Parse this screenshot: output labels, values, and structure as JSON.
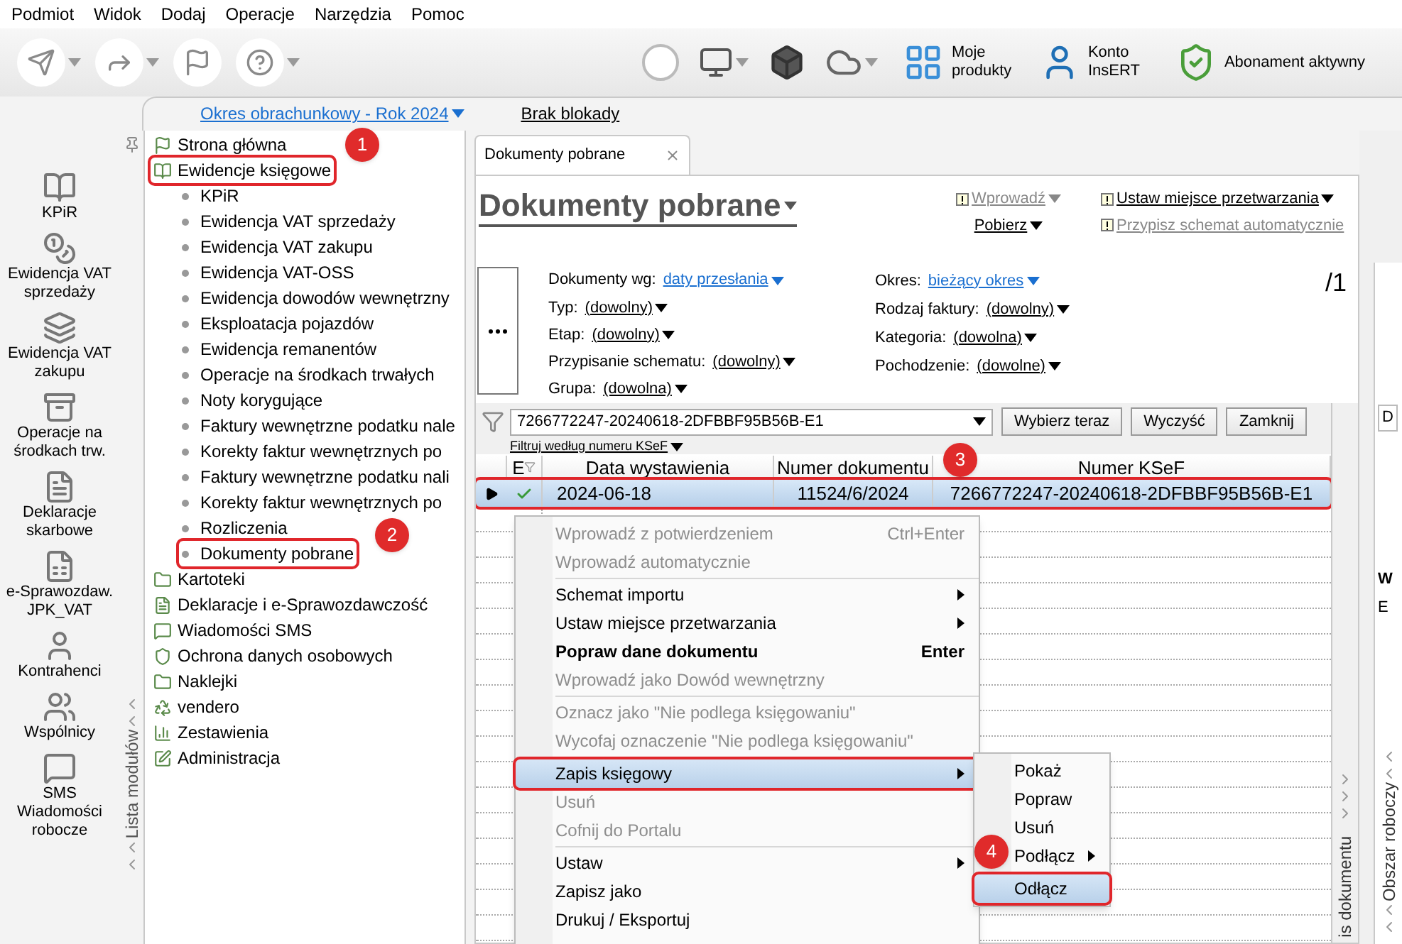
{
  "menu_bar": [
    "Podmiot",
    "Widok",
    "Dodaj",
    "Operacje",
    "Narzędzia",
    "Pomoc"
  ],
  "toolbar": {
    "labeled_buttons": [
      {
        "label": "Moje produkty",
        "kind": "products"
      },
      {
        "label": "Konto InsERT",
        "kind": "account"
      },
      {
        "label": "Abonament aktywny",
        "kind": "subscription"
      }
    ]
  },
  "period_bar": {
    "period": "Okres obrachunkowy - Rok 2024",
    "lock": "Brak blokady"
  },
  "shortcuts": [
    {
      "label": "KPiR",
      "kind": "book"
    },
    {
      "label": "Ewidencja VAT sprzedaży",
      "kind": "coins"
    },
    {
      "label": "Ewidencja VAT zakupu",
      "kind": "binders"
    },
    {
      "label": "Operacje na środkach trw.",
      "kind": "cabinet"
    },
    {
      "label": "Deklaracje skarbowe",
      "kind": "forms"
    },
    {
      "label": "e-Sprawozdaw. JPK_VAT",
      "kind": "jpk"
    },
    {
      "label": "Kontrahenci",
      "kind": "person"
    },
    {
      "label": "Wspólnicy",
      "kind": "people"
    },
    {
      "label": "SMS Wiadomości robocze",
      "kind": "sms"
    }
  ],
  "module_list": {
    "title": "Lista modułów",
    "items": [
      {
        "label": "Strona główna",
        "kind": "flag",
        "outlined": false
      },
      {
        "label": "Ewidencje księgowe",
        "kind": "book",
        "outlined": true,
        "children": [
          {
            "label": "KPiR",
            "outlined": false
          },
          {
            "label": "Ewidencja VAT sprzedaży",
            "outlined": false
          },
          {
            "label": "Ewidencja VAT zakupu",
            "outlined": false
          },
          {
            "label": "Ewidencja VAT-OSS",
            "outlined": false
          },
          {
            "label": "Ewidencja dowodów wewnętrzny",
            "outlined": false
          },
          {
            "label": "Eksploatacja pojazdów",
            "outlined": false
          },
          {
            "label": "Ewidencja remanentów",
            "outlined": false
          },
          {
            "label": "Operacje na środkach trwałych",
            "outlined": false
          },
          {
            "label": "Noty korygujące",
            "outlined": false
          },
          {
            "label": "Faktury wewnętrzne podatku nale",
            "outlined": false
          },
          {
            "label": "Korekty faktur wewnętrznych po",
            "outlined": false
          },
          {
            "label": "Faktury wewnętrzne podatku nali",
            "outlined": false
          },
          {
            "label": "Korekty faktur wewnętrznych po",
            "outlined": false
          },
          {
            "label": "Rozliczenia",
            "outlined": false
          },
          {
            "label": "Dokumenty pobrane",
            "outlined": true
          }
        ]
      },
      {
        "label": "Kartoteki",
        "kind": "folders",
        "outlined": false
      },
      {
        "label": "Deklaracje i e-Sprawozdawczość",
        "kind": "forms",
        "outlined": false
      },
      {
        "label": "Wiadomości SMS",
        "kind": "sms",
        "outlined": false
      },
      {
        "label": "Ochrona danych osobowych",
        "kind": "shield",
        "outlined": false
      },
      {
        "label": "Naklejki",
        "kind": "folders",
        "outlined": false
      },
      {
        "label": "vendero",
        "kind": "recycle",
        "outlined": false
      },
      {
        "label": "Zestawienia",
        "kind": "chart",
        "outlined": false
      },
      {
        "label": "Administracja",
        "kind": "edit",
        "outlined": false
      }
    ]
  },
  "document_tabs": [
    {
      "label": "Dokumenty pobrane",
      "selected": true
    }
  ],
  "page_title": "Dokumenty pobrane",
  "actions": [
    {
      "label": "Wprowadź",
      "disabled": true,
      "flag": true,
      "dropdown": true
    },
    {
      "label": "Ustaw miejsce przetwarzania",
      "disabled": false,
      "flag": true,
      "dropdown": true
    },
    {
      "label": "Pobierz",
      "disabled": false,
      "flag": false,
      "dropdown": true
    },
    {
      "label": "Przypisz schemat automatycznie",
      "disabled": true,
      "flag": true,
      "dropdown": false
    }
  ],
  "counter": "/1",
  "filters_left": [
    {
      "label": "Dokumenty wg:",
      "value": "daty przesłania",
      "kind": "link"
    },
    {
      "label": "Typ:",
      "value": "(dowolny)",
      "kind": "dropdown"
    },
    {
      "label": "Etap:",
      "value": "(dowolny)",
      "kind": "dropdown"
    },
    {
      "label": "Przypisanie schematu:",
      "value": "(dowolny)",
      "kind": "dropdown"
    },
    {
      "label": "Grupa:",
      "value": "(dowolna)",
      "kind": "dropdown"
    }
  ],
  "filters_right": [
    {
      "label": "Okres:",
      "value": "bieżący okres",
      "kind": "link"
    },
    {
      "label": "Rodzaj faktury:",
      "value": "(dowolny)",
      "kind": "dropdown"
    },
    {
      "label": "Kategoria:",
      "value": "(dowolna)",
      "kind": "dropdown"
    },
    {
      "label": "Pochodzenie:",
      "value": "(dowolne)",
      "kind": "dropdown"
    }
  ],
  "search": {
    "value": "7266772247-20240618-2DFBBF95B56B-E1",
    "buttons": [
      "Wybierz teraz",
      "Wyczyść",
      "Zamknij"
    ],
    "filter_mode": "Filtruj według numeru KSeF"
  },
  "table": {
    "columns": [
      "E",
      "Data wystawienia",
      "Numer dokumentu",
      "Numer KSeF"
    ],
    "rows": [
      {
        "selected": true,
        "checked": true,
        "outlined": true,
        "cells": [
          "",
          "2024-06-18",
          "11524/6/2024",
          "7266772247-20240618-2DFBBF95B56B-E1"
        ]
      }
    ]
  },
  "context_menu": [
    {
      "kind": "command",
      "label": "Wprowadź z potwierdzeniem",
      "shortcut": "Ctrl+Enter",
      "disabled": true,
      "submenu": false,
      "selected": false,
      "outlined": false
    },
    {
      "kind": "command",
      "label": "Wprowadź automatycznie",
      "disabled": true,
      "submenu": false,
      "selected": false,
      "outlined": false
    },
    {
      "kind": "separator"
    },
    {
      "kind": "command",
      "label": "Schemat importu",
      "disabled": false,
      "submenu": true,
      "selected": false,
      "outlined": false
    },
    {
      "kind": "command",
      "label": "Ustaw miejsce przetwarzania",
      "disabled": false,
      "submenu": true,
      "selected": false,
      "outlined": false
    },
    {
      "kind": "default",
      "label": "Popraw dane dokumentu",
      "shortcut": "Enter",
      "disabled": false,
      "submenu": false,
      "selected": false,
      "outlined": false
    },
    {
      "kind": "command",
      "label": "Wprowadź jako Dowód wewnętrzny",
      "disabled": true,
      "submenu": false,
      "selected": false,
      "outlined": false
    },
    {
      "kind": "separator"
    },
    {
      "kind": "command",
      "label": "Oznacz jako \"Nie podlega księgowaniu\"",
      "disabled": true,
      "submenu": false,
      "selected": false,
      "outlined": false
    },
    {
      "kind": "command",
      "label": "Wycofaj oznaczenie \"Nie podlega księgowaniu\"",
      "disabled": true,
      "submenu": false,
      "selected": false,
      "outlined": false
    },
    {
      "kind": "separator"
    },
    {
      "kind": "command",
      "label": "Zapis księgowy",
      "disabled": false,
      "submenu": true,
      "selected": true,
      "outlined": true
    },
    {
      "kind": "command",
      "label": "Usuń",
      "disabled": true,
      "submenu": false,
      "selected": false,
      "outlined": false
    },
    {
      "kind": "command",
      "label": "Cofnij do Portalu",
      "disabled": true,
      "submenu": false,
      "selected": false,
      "outlined": false
    },
    {
      "kind": "separator"
    },
    {
      "kind": "command",
      "label": "Ustaw",
      "disabled": false,
      "submenu": true,
      "selected": false,
      "outlined": false
    },
    {
      "kind": "command",
      "label": "Zapisz jako",
      "disabled": false,
      "submenu": false,
      "selected": false,
      "outlined": false
    },
    {
      "kind": "command",
      "label": "Drukuj / Eksportuj",
      "disabled": false,
      "submenu": false,
      "selected": false,
      "outlined": false
    }
  ],
  "submenu": [
    {
      "kind": "command",
      "label": "Pokaż",
      "submenu": false,
      "selected": false,
      "outlined": false
    },
    {
      "kind": "command",
      "label": "Popraw",
      "submenu": false,
      "selected": false,
      "outlined": false
    },
    {
      "kind": "command",
      "label": "Usuń",
      "submenu": false,
      "selected": false,
      "outlined": false
    },
    {
      "kind": "command",
      "label": "Podłącz",
      "submenu": true,
      "selected": false,
      "outlined": false
    },
    {
      "kind": "separator"
    },
    {
      "kind": "command",
      "label": "Odłącz",
      "submenu": false,
      "selected": true,
      "outlined": true
    }
  ],
  "callouts": [
    "1",
    "2",
    "3",
    "4"
  ],
  "side_panels": {
    "description_tab": "is dokumentu",
    "workspace_tab": "Obszar roboczy",
    "workspace_page_tab": "D",
    "workspace_fragments": [
      "W",
      "E"
    ]
  }
}
